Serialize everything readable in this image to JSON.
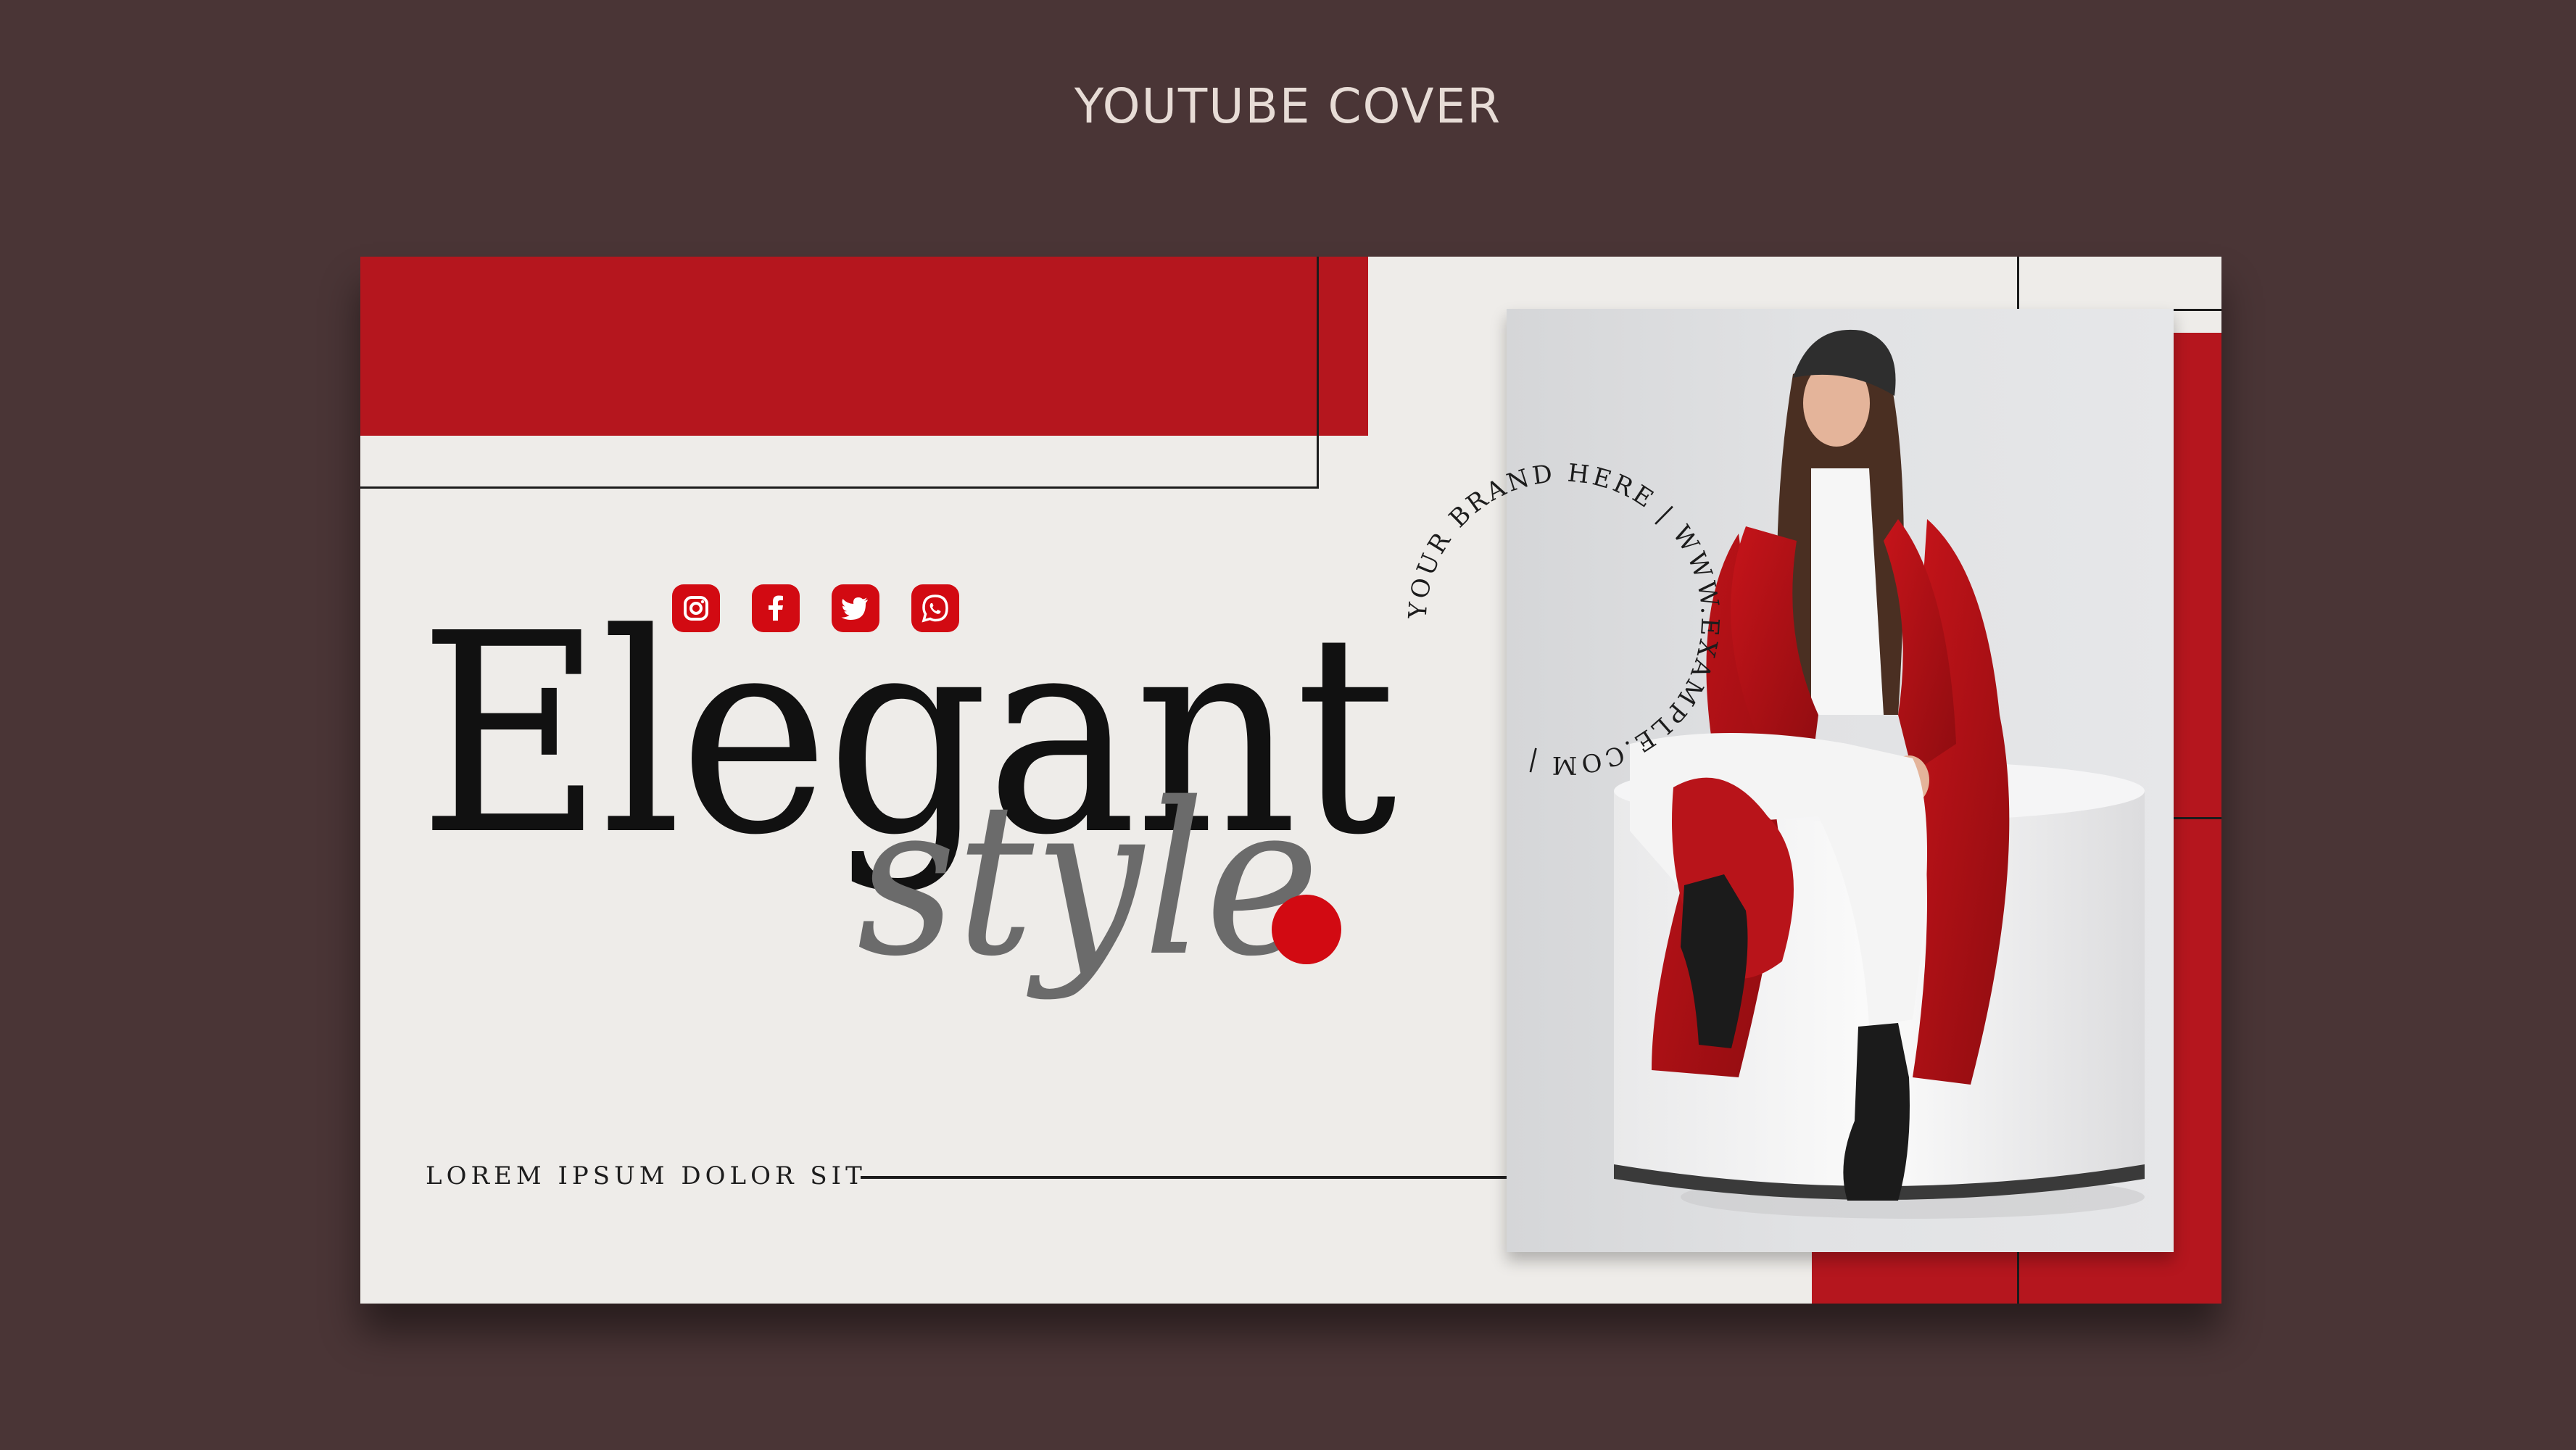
{
  "page": {
    "heading": "YOUTUBE COVER"
  },
  "cover": {
    "headline": "Elegant",
    "subhead": "style",
    "tagline": "LOREM IPSUM DOLOR SIT",
    "badge_text": "YOUR BRAND HERE | WWW.EXAMPLE.COM |",
    "social_icons": [
      "instagram-icon",
      "facebook-icon",
      "twitter-icon",
      "whatsapp-icon"
    ],
    "photo_subject": "model in red coat seated on white cylinder"
  },
  "colors": {
    "background": "#4a3536",
    "cover_bg": "#eeece9",
    "accent_red": "#b5161e",
    "icon_red": "#d20a12",
    "ink": "#111111",
    "subhead_gray": "#6b6b6b"
  }
}
